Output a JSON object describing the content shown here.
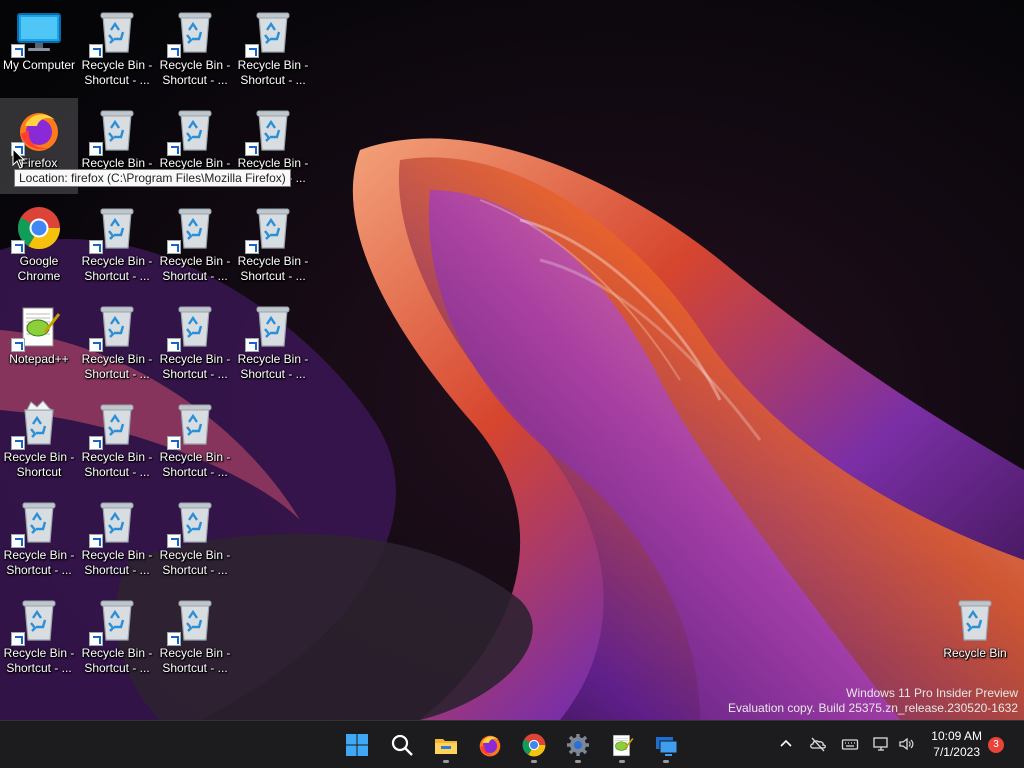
{
  "desktop": {
    "icons": [
      {
        "label": "My Computer",
        "icon": "monitor-icon"
      },
      {
        "label": "Recycle Bin -\nShortcut - ...",
        "icon": "recycle-bin-icon"
      },
      {
        "label": "Recycle Bin -\nShortcut - ...",
        "icon": "recycle-bin-icon"
      },
      {
        "label": "Recycle Bin -\nShortcut - ...",
        "icon": "recycle-bin-icon"
      },
      {
        "label": "Firefox",
        "icon": "firefox-icon"
      },
      {
        "label": "Recycle Bin -\nShortcut - ...",
        "icon": "recycle-bin-icon"
      },
      {
        "label": "Recycle Bin -\nShortcut - ...",
        "icon": "recycle-bin-icon"
      },
      {
        "label": "Recycle Bin -\nShortcut - ...",
        "icon": "recycle-bin-icon"
      },
      {
        "label": "Google\nChrome",
        "icon": "chrome-icon"
      },
      {
        "label": "Recycle Bin -\nShortcut - ...",
        "icon": "recycle-bin-icon"
      },
      {
        "label": "Recycle Bin -\nShortcut - ...",
        "icon": "recycle-bin-icon"
      },
      {
        "label": "Recycle Bin -\nShortcut - ...",
        "icon": "recycle-bin-icon"
      },
      {
        "label": "Notepad++",
        "icon": "notepadpp-icon"
      },
      {
        "label": "Recycle Bin -\nShortcut - ...",
        "icon": "recycle-bin-icon"
      },
      {
        "label": "Recycle Bin -\nShortcut - ...",
        "icon": "recycle-bin-icon"
      },
      {
        "label": "Recycle Bin -\nShortcut - ...",
        "icon": "recycle-bin-icon"
      },
      {
        "label": "Recycle Bin -\nShortcut",
        "icon": "recycle-bin-full-icon"
      },
      {
        "label": "Recycle Bin -\nShortcut - ...",
        "icon": "recycle-bin-icon"
      },
      {
        "label": "Recycle Bin -\nShortcut - ...",
        "icon": "recycle-bin-icon"
      },
      {
        "label": "Recycle Bin -\nShortcut - ...",
        "icon": "recycle-bin-icon"
      },
      {
        "label": "Recycle Bin -\nShortcut - ...",
        "icon": "recycle-bin-icon"
      },
      {
        "label": "Recycle Bin -\nShortcut - ...",
        "icon": "recycle-bin-icon"
      },
      {
        "label": "Recycle Bin -\nShortcut - ...",
        "icon": "recycle-bin-icon"
      },
      {
        "label": "Recycle Bin -\nShortcut - ...",
        "icon": "recycle-bin-icon"
      },
      {
        "label": "Recycle Bin -\nShortcut - ...",
        "icon": "recycle-bin-icon"
      },
      {
        "label": "Recycle Bin",
        "icon": "recycle-bin-icon"
      }
    ],
    "tooltip": "Location: firefox (C:\\Program Files\\Mozilla Firefox)",
    "selected_icon": "Firefox"
  },
  "watermark": {
    "line1": "Windows 11 Pro Insider Preview",
    "line2": "Evaluation copy. Build 25375.zn_release.230520-1632"
  },
  "taskbar": {
    "apps": [
      {
        "name": "Start",
        "icon": "windows-start-icon",
        "running": false
      },
      {
        "name": "Search",
        "icon": "search-icon",
        "running": false
      },
      {
        "name": "File Explorer",
        "icon": "file-explorer-icon",
        "running": true
      },
      {
        "name": "Firefox",
        "icon": "firefox-icon",
        "running": false
      },
      {
        "name": "Google Chrome",
        "icon": "chrome-icon",
        "running": true
      },
      {
        "name": "Settings",
        "icon": "settings-gear-icon",
        "running": true
      },
      {
        "name": "Notepad++",
        "icon": "notepadpp-icon",
        "running": true
      },
      {
        "name": "Remote Desktop",
        "icon": "remote-desktop-icon",
        "running": true
      }
    ],
    "tray": {
      "icons": [
        "chevron-up-icon",
        "onedrive-offline-icon",
        "keyboard-icon",
        "network-icon",
        "volume-icon"
      ],
      "time": "10:09 AM",
      "date": "7/1/2023",
      "notification_count": "3"
    }
  },
  "colors": {
    "taskbar_bg": "#1c1c1f",
    "tooltip_bg": "#f9f9f9",
    "badge": "#e8443a",
    "wallpaper_accent_orange": "#e8622a",
    "wallpaper_accent_purple": "#7a3fb0"
  }
}
